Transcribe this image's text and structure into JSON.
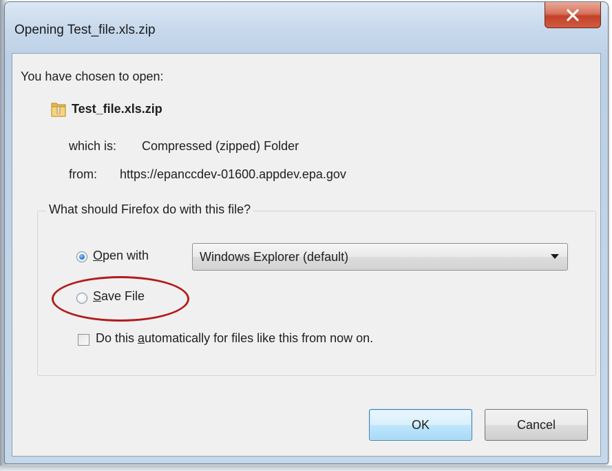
{
  "dialog": {
    "title": "Opening Test_file.xls.zip",
    "close_icon": "close-icon",
    "intro": "You have chosen to open:",
    "file_icon": "zip-folder-icon",
    "file_name": "Test_file.xls.zip",
    "which_label": "which is:",
    "which_value": "Compressed (zipped) Folder",
    "from_label": "from:",
    "from_value": "https://epanccdev-01600.appdev.epa.gov",
    "group_legend": "What should Firefox do with this file?",
    "open_with": {
      "label_accel": "O",
      "label_rest": "pen with",
      "selected": true,
      "select_value": "Windows Explorer (default)"
    },
    "save_file": {
      "label_accel": "S",
      "label_rest": "ave File",
      "selected": false,
      "highlight_color": "#b11c1c"
    },
    "auto_checkbox": {
      "label_before": "Do this ",
      "label_accel": "a",
      "label_after": "utomatically for files like this from now on.",
      "checked": false
    },
    "ok_label": "OK",
    "cancel_label": "Cancel"
  }
}
